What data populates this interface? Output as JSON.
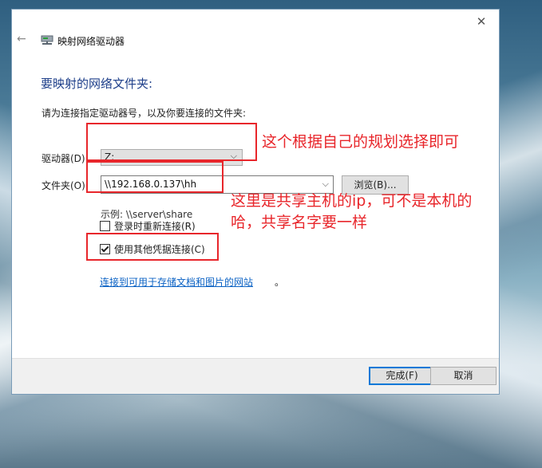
{
  "dialog": {
    "title": "映射网络驱动器",
    "heading": "要映射的网络文件夹:",
    "instruction": "请为连接指定驱动器号，以及你要连接的文件夹:",
    "drive_label": "驱动器(D):",
    "drive_value": "Z:",
    "folder_label": "文件夹(O):",
    "folder_value": "\\\\192.168.0.137\\hh",
    "browse_label": "浏览(B)...",
    "example": "示例: \\\\server\\share",
    "reconnect_label": "登录时重新连接(R)",
    "reconnect_checked": false,
    "other_credentials_label": "使用其他凭据连接(C)",
    "other_credentials_checked": true,
    "link_text": "连接到可用于存储文档和图片的网站",
    "link_suffix": "。",
    "finish_label": "完成(F)",
    "cancel_label": "取消"
  },
  "annotations": {
    "drive_note": "这个根据自己的规划选择即可",
    "folder_note_line1": "这里是共享主机的ip，可不是本机的",
    "folder_note_line2": "哈，共享名字要一样"
  },
  "colors": {
    "annotation": "#e8262b",
    "heading": "#1e3f8a",
    "link": "#0b62c4",
    "primary_border": "#0078d7"
  }
}
